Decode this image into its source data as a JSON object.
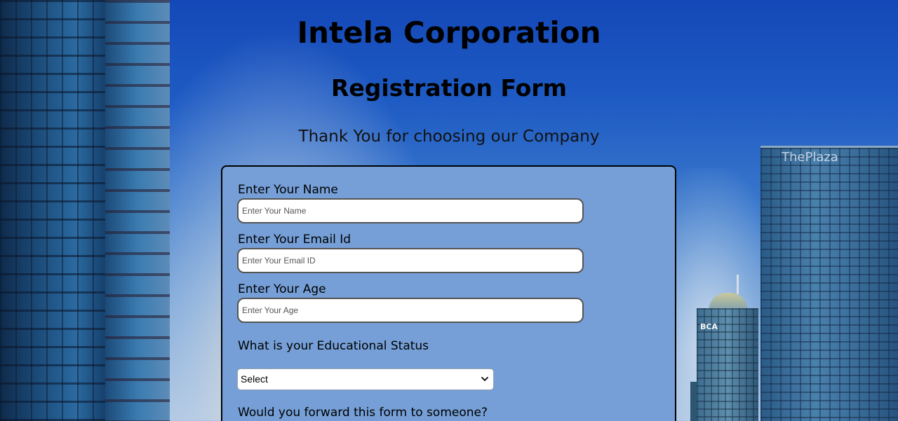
{
  "header": {
    "company": "Intela Corporation",
    "form_title": "Registration Form",
    "tagline": "Thank You for choosing our Company"
  },
  "background": {
    "sign_plaza": "ThePlaza",
    "sign_bca": "BCA"
  },
  "form": {
    "name": {
      "label": "Enter Your Name",
      "placeholder": "Enter Your Name",
      "value": ""
    },
    "email": {
      "label": "Enter Your Email Id",
      "placeholder": "Enter Your Email ID",
      "value": ""
    },
    "age": {
      "label": "Enter Your Age",
      "placeholder": "Enter Your Age",
      "value": ""
    },
    "education": {
      "label": "What is your Educational Status",
      "selected": "Select",
      "icon": "chevron-down-icon"
    },
    "forward": {
      "label": "Would you forward this form to someone?"
    }
  },
  "colors": {
    "form_background": "#759fd6",
    "form_border": "#000000",
    "input_border": "#555555"
  }
}
